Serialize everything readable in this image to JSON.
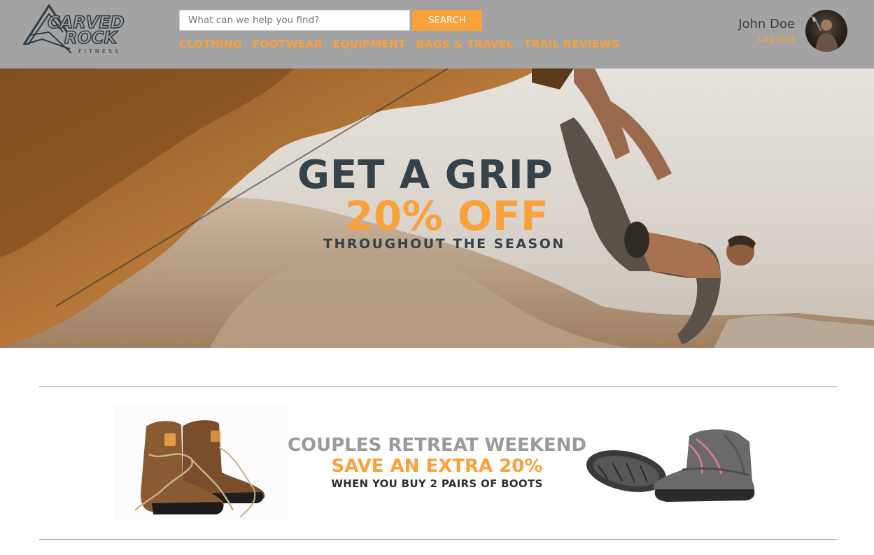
{
  "brand": {
    "logo_text_line1": "CARVED",
    "logo_text_line2": "ROCK",
    "logo_text_line3": "FITNESS"
  },
  "search": {
    "placeholder": "What can we help you find?",
    "button_label": "SEARCH"
  },
  "nav": {
    "items": [
      {
        "label": "CLOTHING"
      },
      {
        "label": "FOOTWEAR"
      },
      {
        "label": "EQUIPMENT"
      },
      {
        "label": "BAGS & TRAVEL"
      },
      {
        "label": "TRAIL REVIEWS"
      }
    ]
  },
  "user": {
    "name": "John Doe",
    "logout_label": "Log Out"
  },
  "hero": {
    "title": "GET A GRIP",
    "discount": "20% OFF",
    "subtitle": "THROUGHOUT THE SEASON"
  },
  "promo": {
    "title": "COUPLES RETREAT WEEKEND",
    "save": "SAVE AN EXTRA 20%",
    "subtitle": "WHEN YOU BUY 2 PAIRS OF BOOTS"
  },
  "colors": {
    "header_bg": "#a3a3a3",
    "accent": "#f9a13b",
    "dark_text": "#36424a",
    "promo_gray": "#9a9a9a"
  },
  "icons": {
    "logo": "carved-rock-mountain-logo",
    "avatar": "user-avatar-photo",
    "hero_image": "rock-climber-photo",
    "left_product": "brown-hiking-boots-photo",
    "right_product": "gray-pink-hiking-boots-photo"
  }
}
